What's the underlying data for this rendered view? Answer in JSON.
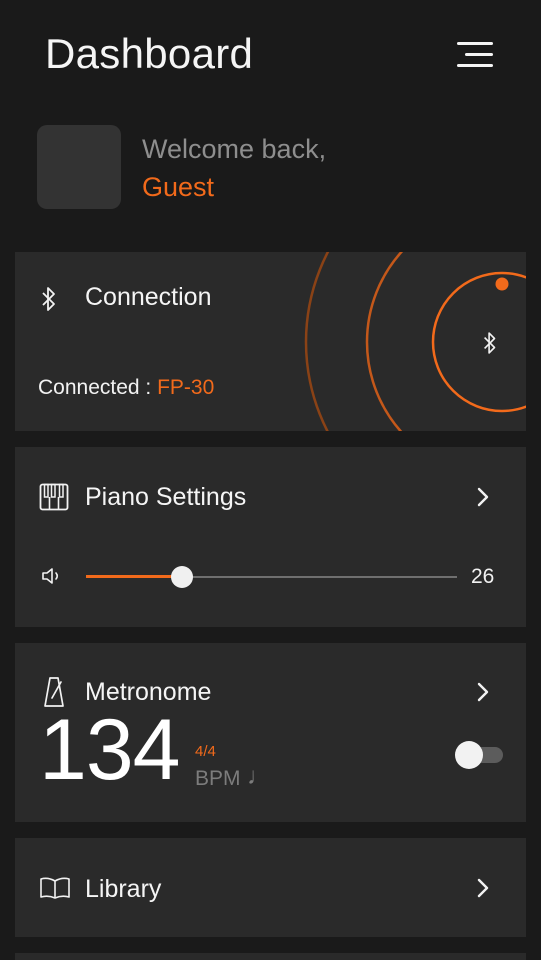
{
  "header": {
    "title": "Dashboard"
  },
  "user": {
    "welcome": "Welcome back,",
    "name": "Guest"
  },
  "connection": {
    "title": "Connected : ",
    "heading": "Connection",
    "device": "FP-30"
  },
  "piano": {
    "title": "Piano Settings",
    "volume": 26,
    "volume_max": 100
  },
  "metronome": {
    "title": "Metronome",
    "bpm": "134",
    "time_signature": "4/4",
    "unit": "BPM",
    "note_glyph": "♩",
    "enabled": false
  },
  "library": {
    "title": "Library"
  },
  "colors": {
    "accent": "#f26a1b",
    "background": "#1a1a1a",
    "card": "#2a2a2a"
  }
}
